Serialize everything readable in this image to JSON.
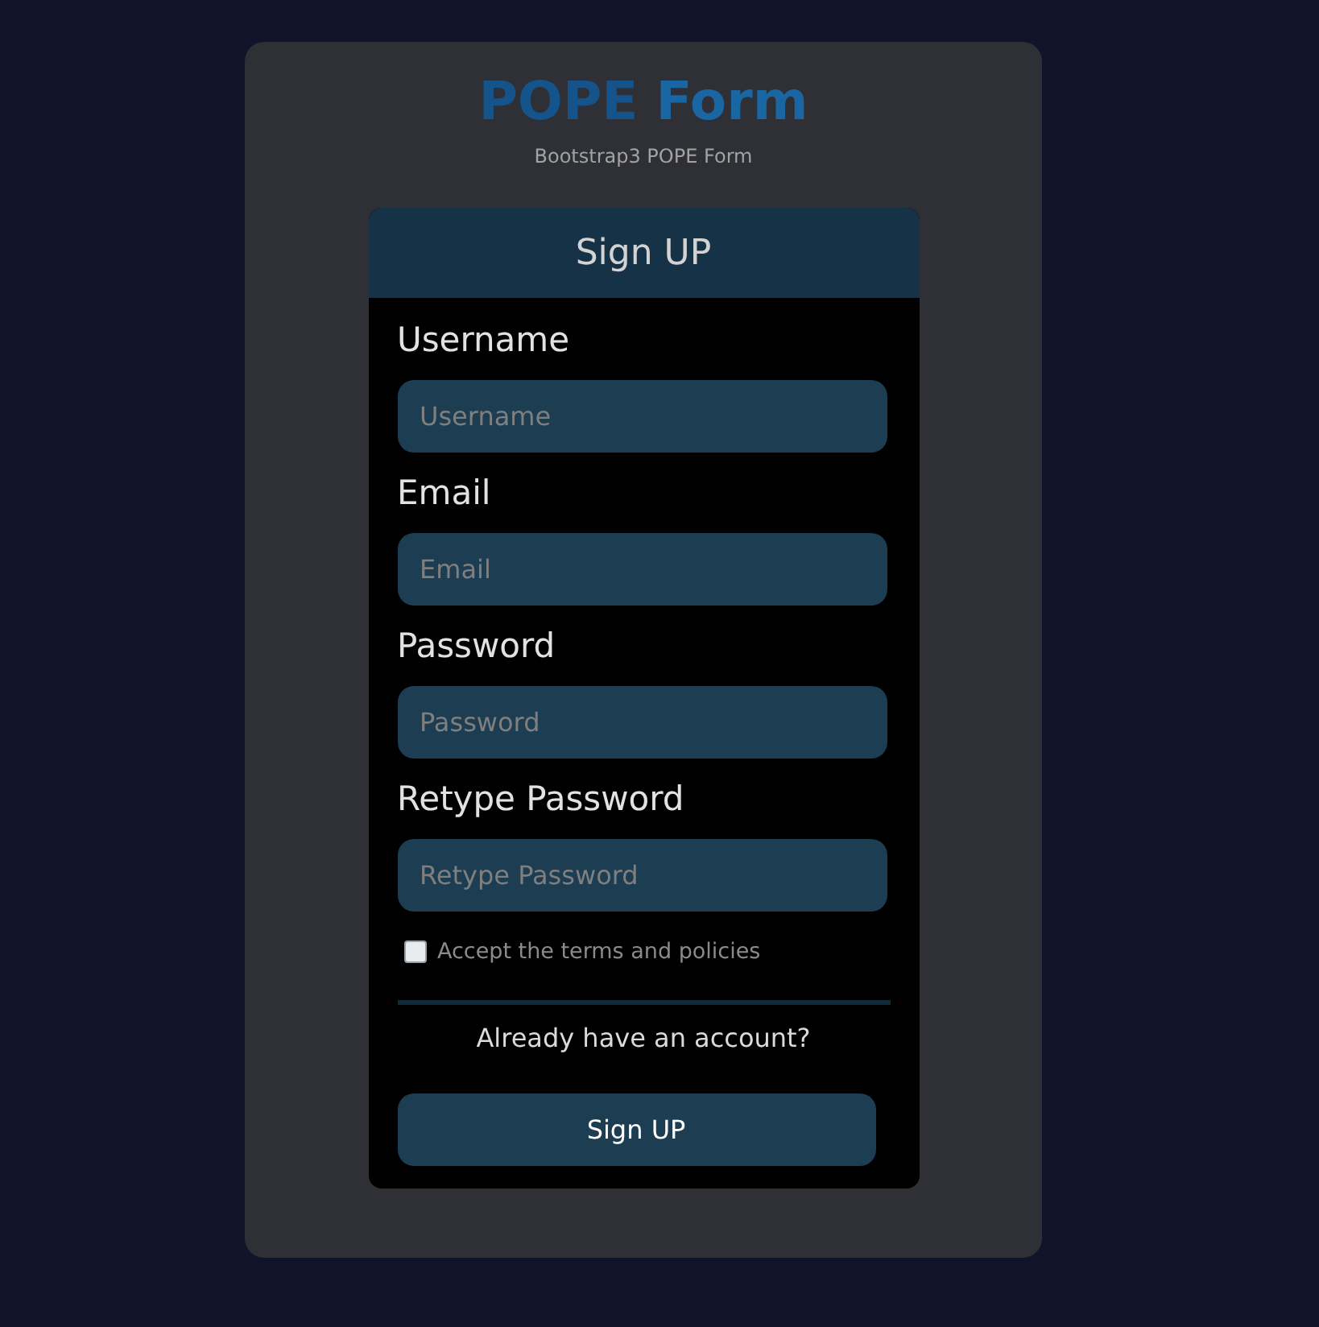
{
  "header": {
    "title_lead": "POPE",
    "title_main": "Form",
    "subtitle": "Bootstrap3 POPE Form"
  },
  "form": {
    "heading": "Sign UP",
    "fields": [
      {
        "label": "Username",
        "placeholder": "Username"
      },
      {
        "label": "Email",
        "placeholder": "Email"
      },
      {
        "label": "Password",
        "placeholder": "Password"
      },
      {
        "label": "Retype Password",
        "placeholder": "Retype Password"
      }
    ],
    "terms": {
      "label": "Accept the terms and policies",
      "checked": false
    },
    "signin_prompt": "Already have an account?",
    "submit": "Sign UP"
  }
}
